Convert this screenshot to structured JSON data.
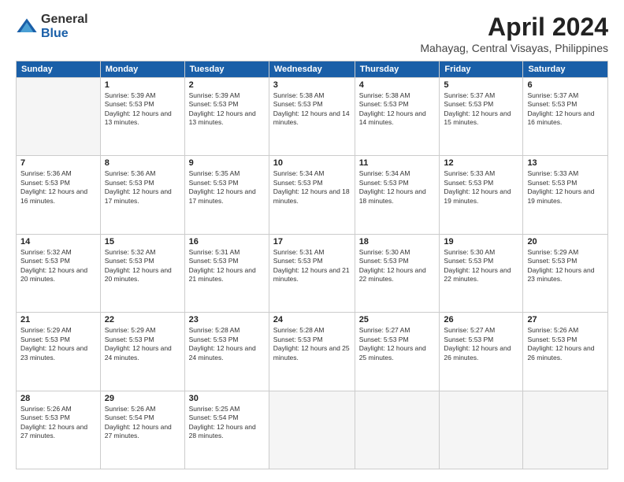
{
  "logo": {
    "general": "General",
    "blue": "Blue"
  },
  "title": "April 2024",
  "subtitle": "Mahayag, Central Visayas, Philippines",
  "weekdays": [
    "Sunday",
    "Monday",
    "Tuesday",
    "Wednesday",
    "Thursday",
    "Friday",
    "Saturday"
  ],
  "weeks": [
    [
      {
        "day": null
      },
      {
        "day": "1",
        "sunrise": "5:39 AM",
        "sunset": "5:53 PM",
        "daylight": "12 hours and 13 minutes."
      },
      {
        "day": "2",
        "sunrise": "5:39 AM",
        "sunset": "5:53 PM",
        "daylight": "12 hours and 13 minutes."
      },
      {
        "day": "3",
        "sunrise": "5:38 AM",
        "sunset": "5:53 PM",
        "daylight": "12 hours and 14 minutes."
      },
      {
        "day": "4",
        "sunrise": "5:38 AM",
        "sunset": "5:53 PM",
        "daylight": "12 hours and 14 minutes."
      },
      {
        "day": "5",
        "sunrise": "5:37 AM",
        "sunset": "5:53 PM",
        "daylight": "12 hours and 15 minutes."
      },
      {
        "day": "6",
        "sunrise": "5:37 AM",
        "sunset": "5:53 PM",
        "daylight": "12 hours and 16 minutes."
      }
    ],
    [
      {
        "day": "7",
        "sunrise": "5:36 AM",
        "sunset": "5:53 PM",
        "daylight": "12 hours and 16 minutes."
      },
      {
        "day": "8",
        "sunrise": "5:36 AM",
        "sunset": "5:53 PM",
        "daylight": "12 hours and 17 minutes."
      },
      {
        "day": "9",
        "sunrise": "5:35 AM",
        "sunset": "5:53 PM",
        "daylight": "12 hours and 17 minutes."
      },
      {
        "day": "10",
        "sunrise": "5:34 AM",
        "sunset": "5:53 PM",
        "daylight": "12 hours and 18 minutes."
      },
      {
        "day": "11",
        "sunrise": "5:34 AM",
        "sunset": "5:53 PM",
        "daylight": "12 hours and 18 minutes."
      },
      {
        "day": "12",
        "sunrise": "5:33 AM",
        "sunset": "5:53 PM",
        "daylight": "12 hours and 19 minutes."
      },
      {
        "day": "13",
        "sunrise": "5:33 AM",
        "sunset": "5:53 PM",
        "daylight": "12 hours and 19 minutes."
      }
    ],
    [
      {
        "day": "14",
        "sunrise": "5:32 AM",
        "sunset": "5:53 PM",
        "daylight": "12 hours and 20 minutes."
      },
      {
        "day": "15",
        "sunrise": "5:32 AM",
        "sunset": "5:53 PM",
        "daylight": "12 hours and 20 minutes."
      },
      {
        "day": "16",
        "sunrise": "5:31 AM",
        "sunset": "5:53 PM",
        "daylight": "12 hours and 21 minutes."
      },
      {
        "day": "17",
        "sunrise": "5:31 AM",
        "sunset": "5:53 PM",
        "daylight": "12 hours and 21 minutes."
      },
      {
        "day": "18",
        "sunrise": "5:30 AM",
        "sunset": "5:53 PM",
        "daylight": "12 hours and 22 minutes."
      },
      {
        "day": "19",
        "sunrise": "5:30 AM",
        "sunset": "5:53 PM",
        "daylight": "12 hours and 22 minutes."
      },
      {
        "day": "20",
        "sunrise": "5:29 AM",
        "sunset": "5:53 PM",
        "daylight": "12 hours and 23 minutes."
      }
    ],
    [
      {
        "day": "21",
        "sunrise": "5:29 AM",
        "sunset": "5:53 PM",
        "daylight": "12 hours and 23 minutes."
      },
      {
        "day": "22",
        "sunrise": "5:29 AM",
        "sunset": "5:53 PM",
        "daylight": "12 hours and 24 minutes."
      },
      {
        "day": "23",
        "sunrise": "5:28 AM",
        "sunset": "5:53 PM",
        "daylight": "12 hours and 24 minutes."
      },
      {
        "day": "24",
        "sunrise": "5:28 AM",
        "sunset": "5:53 PM",
        "daylight": "12 hours and 25 minutes."
      },
      {
        "day": "25",
        "sunrise": "5:27 AM",
        "sunset": "5:53 PM",
        "daylight": "12 hours and 25 minutes."
      },
      {
        "day": "26",
        "sunrise": "5:27 AM",
        "sunset": "5:53 PM",
        "daylight": "12 hours and 26 minutes."
      },
      {
        "day": "27",
        "sunrise": "5:26 AM",
        "sunset": "5:53 PM",
        "daylight": "12 hours and 26 minutes."
      }
    ],
    [
      {
        "day": "28",
        "sunrise": "5:26 AM",
        "sunset": "5:53 PM",
        "daylight": "12 hours and 27 minutes."
      },
      {
        "day": "29",
        "sunrise": "5:26 AM",
        "sunset": "5:54 PM",
        "daylight": "12 hours and 27 minutes."
      },
      {
        "day": "30",
        "sunrise": "5:25 AM",
        "sunset": "5:54 PM",
        "daylight": "12 hours and 28 minutes."
      },
      {
        "day": null
      },
      {
        "day": null
      },
      {
        "day": null
      },
      {
        "day": null
      }
    ]
  ]
}
